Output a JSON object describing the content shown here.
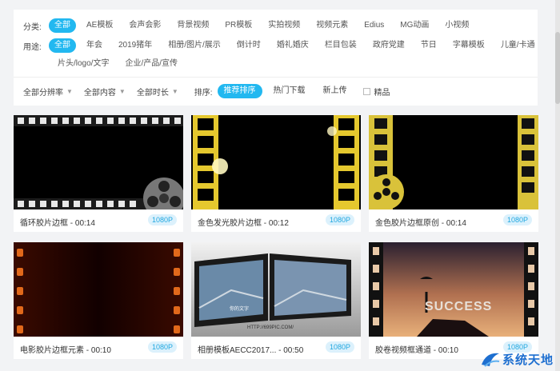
{
  "filters": {
    "category_label": "分类:",
    "categories": [
      "全部",
      "AE模板",
      "会声会影",
      "背景视频",
      "PR模板",
      "实拍视频",
      "视频元素",
      "Edius",
      "MG动画",
      "小视频"
    ],
    "usage_label": "用途:",
    "usages": [
      "全部",
      "年会",
      "2019猪年",
      "相册/图片/展示",
      "倒计时",
      "婚礼婚庆",
      "栏目包装",
      "政府党建",
      "节日",
      "字幕模板",
      "儿童/卡通"
    ],
    "usages_row2": [
      "片头/logo/文字",
      "企业/产品/宣传"
    ]
  },
  "sort_bar": {
    "resolution": "全部分辨率",
    "content": "全部内容",
    "duration": "全部时长",
    "sort_label": "排序:",
    "sorts": [
      "推荐排序",
      "热门下载",
      "新上传"
    ],
    "premium": "精品"
  },
  "cards": [
    {
      "title": "循环胶片边框 - 00:14",
      "res": "1080P"
    },
    {
      "title": "金色发光胶片边框 - 00:12",
      "res": "1080P"
    },
    {
      "title": "金色胶片边框原创 - 00:14",
      "res": "1080P"
    },
    {
      "title": "电影胶片边框元素 - 00:10",
      "res": "1080P"
    },
    {
      "title": "相册模板AECC2017... - 00:50",
      "res": "1080P"
    },
    {
      "title": "胶卷视频框通道 - 00:10",
      "res": "1080P"
    }
  ],
  "thumb_text": {
    "photo_caption": "你的文字",
    "photo_url": "HTTP://699PIC.COM/",
    "success": "SUCCESS"
  },
  "watermark": "系统天地",
  "colors": {
    "accent": "#22b8f0",
    "badge_bg": "#dcf1fc",
    "film_gold": "#e8d03a",
    "film_border": "#1a1a1a"
  }
}
